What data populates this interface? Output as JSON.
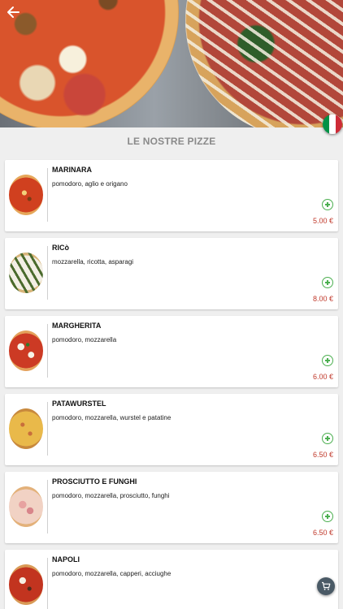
{
  "header": {
    "back_icon": "back-arrow-icon",
    "flag_icon": "italian-flag-icon",
    "flag_colors": [
      "#009246",
      "#ffffff",
      "#ce2b37"
    ]
  },
  "section_title": "LE NOSTRE PIZZE",
  "colors": {
    "add_button": "#4caf50",
    "price": "#c0392b"
  },
  "pizzas": [
    {
      "name": "MARINARA",
      "description": "pomodoro, aglio e origano",
      "price": "5.00 €"
    },
    {
      "name": "RICò",
      "description": "mozzarella, ricotta, asparagi",
      "price": "8.00 €"
    },
    {
      "name": "MARGHERITA",
      "description": "pomodoro, mozzarella",
      "price": "6.00 €"
    },
    {
      "name": "PATAWURSTEL",
      "description": "pomodoro, mozzarella, wurstel e patatine",
      "price": "6.50 €"
    },
    {
      "name": "PROSCIUTTO E FUNGHI",
      "description": "pomodoro, mozzarella, prosciutto, funghi",
      "price": "6.50 €"
    },
    {
      "name": "NAPOLI",
      "description": "pomodoro, mozzarella, capperi, acciughe",
      "price": ""
    }
  ],
  "cart": {
    "icon": "cart-icon"
  }
}
